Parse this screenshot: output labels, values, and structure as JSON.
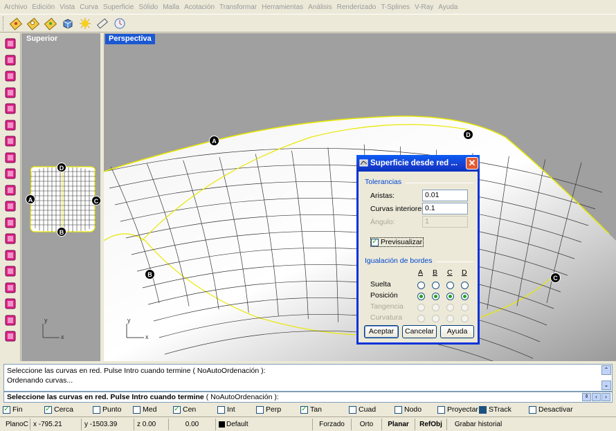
{
  "menu": [
    "Archivo",
    "Edición",
    "Vista",
    "Curva",
    "Superficie",
    "Sólido",
    "Malla",
    "Acotación",
    "Transformar",
    "Herramientas",
    "Análisis",
    "Renderizado",
    "T-Splines",
    "V-Ray",
    "Ayuda"
  ],
  "viewports": {
    "top": {
      "title": "Superior",
      "axis_x": "x",
      "axis_y": "y"
    },
    "persp": {
      "title": "Perspectiva",
      "axis_x": "x",
      "axis_y": "y"
    }
  },
  "markers": {
    "a": "A",
    "b": "B",
    "c": "C",
    "d": "D"
  },
  "dialog": {
    "title": "Superficie desde red ...",
    "close": "✕",
    "tolerances_group": "Tolerancias",
    "edges_label": "Aristas:",
    "edges_value": "0.01",
    "interior_label": "Curvas interiores:",
    "interior_value": "0.1",
    "angle_label": "Ángulo:",
    "angle_value": "1",
    "preview_label": "Previsualizar",
    "preview_checked": true,
    "edge_match_group": "Igualación de bordes",
    "columns": [
      "A",
      "B",
      "C",
      "D"
    ],
    "rows": [
      "Suelta",
      "Posición",
      "Tangencia",
      "Curvatura"
    ],
    "ok": "Aceptar",
    "cancel": "Cancelar",
    "help": "Ayuda"
  },
  "command": {
    "history1": "Seleccione las curvas en red. Pulse Intro cuando termine ( NoAutoOrdenación ):",
    "history2": "Ordenando curvas...",
    "prompt_bold": "Seleccione las curvas en red. Pulse Intro cuando termine",
    "prompt_rest": " ( NoAutoOrdenación ):"
  },
  "osnaps": [
    {
      "label": "Fin",
      "checked": true
    },
    {
      "label": "Cerca",
      "checked": true
    },
    {
      "label": "Punto",
      "checked": false
    },
    {
      "label": "Med",
      "checked": false
    },
    {
      "label": "Cen",
      "checked": true
    },
    {
      "label": "Int",
      "checked": false
    },
    {
      "label": "Perp",
      "checked": false
    },
    {
      "label": "Tan",
      "checked": true
    },
    {
      "label": "Cuad",
      "checked": false
    },
    {
      "label": "Nodo",
      "checked": false
    },
    {
      "label": "Proyectar",
      "checked": false
    },
    {
      "label": "STrack",
      "checked": true
    },
    {
      "label": "Desactivar",
      "checked": false
    }
  ],
  "status": {
    "plane": "PlanoC",
    "x": "x -795.21",
    "y": "y -1503.39",
    "z": "z 0.00",
    "d": "0.00",
    "layer": "Default",
    "forzado": "Forzado",
    "orto": "Orto",
    "planar": "Planar",
    "refobj": "RefObj",
    "history": "Grabar historial"
  },
  "colors": {
    "accent": "#0a5cf5",
    "curve_yellow": "#e8e800",
    "viewport_bg": "#a0a0a0",
    "title_active": "#1b58d2"
  }
}
